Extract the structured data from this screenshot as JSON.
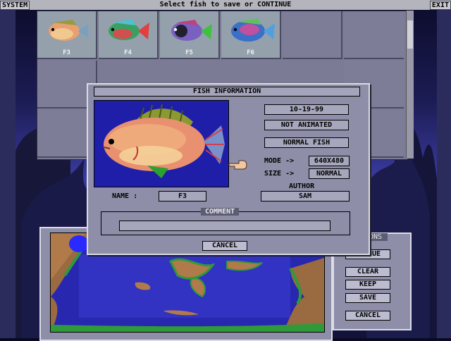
{
  "menu": {
    "system_label": "SYSTEM",
    "title": "Select fish to save or CONTINUE",
    "exit_label": "EXIT"
  },
  "grid": {
    "fish": [
      {
        "label": "F3"
      },
      {
        "label": "F4"
      },
      {
        "label": "F5"
      },
      {
        "label": "F6"
      }
    ]
  },
  "dialog": {
    "title": "FISH INFORMATION",
    "date": "10-19-99",
    "animation": "NOT ANIMATED",
    "fish_type": "NORMAL FISH",
    "mode_label": "MODE ->",
    "mode_value": "640X480",
    "size_label": "SIZE ->",
    "size_value": "NORMAL",
    "author_label": "AUTHOR",
    "author_value": "SAM",
    "name_label": "NAME :",
    "name_value": "F3",
    "comment_label": "COMMENT",
    "comment_value": "",
    "cancel_label": "CANCEL"
  },
  "options": {
    "title": "IONS",
    "continue_label": "NTINUE",
    "clear_label": "CLEAR",
    "keep_label": "KEEP",
    "save_label": "SAVE",
    "cancel_label": "CANCEL"
  },
  "colors": {
    "panel": "#8e8ea8",
    "field": "#a6a6bd",
    "ocean": "#2727b0",
    "reef": "#2e9a3a"
  }
}
